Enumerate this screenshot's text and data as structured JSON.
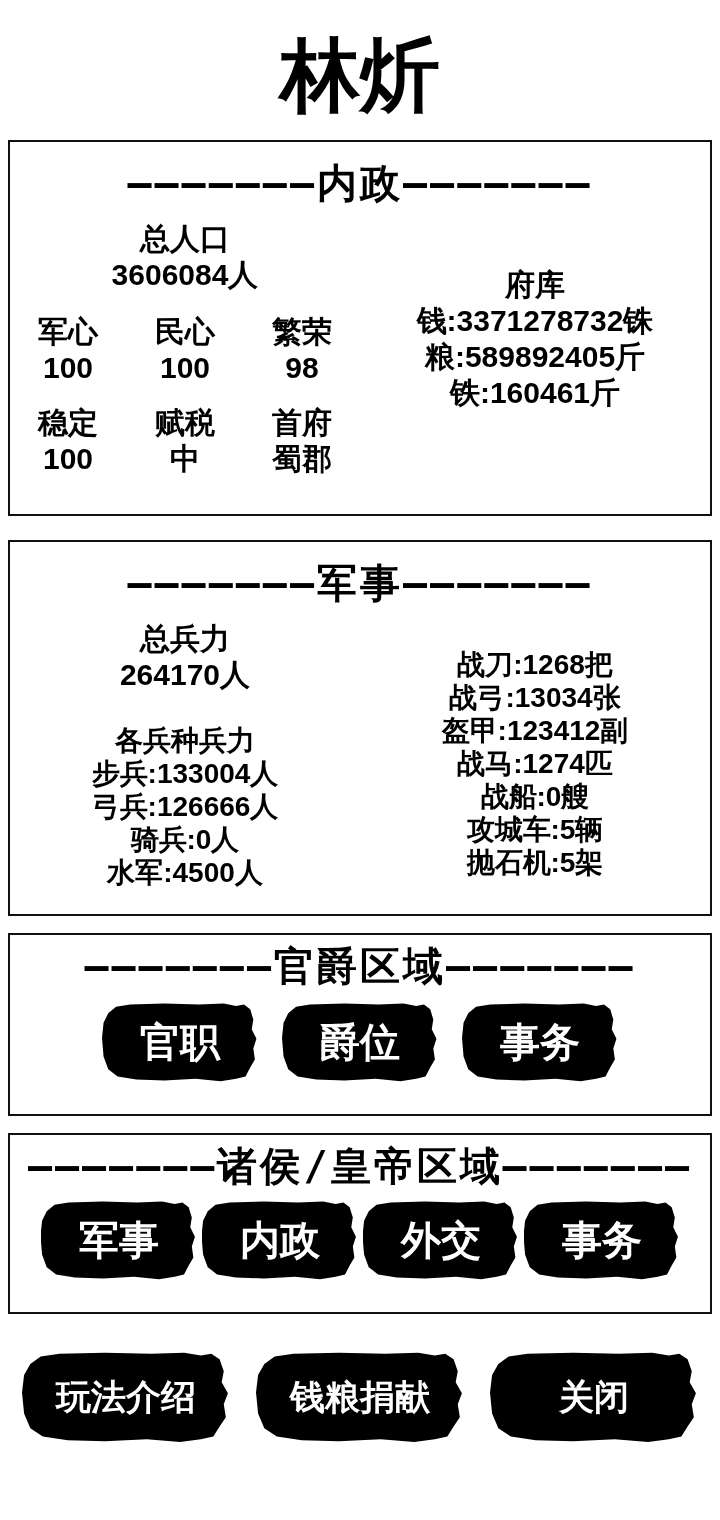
{
  "title": "林炘",
  "sections": [
    {
      "kind": "domestic",
      "heading": "———————内政———————",
      "population": {
        "label": "总人口",
        "value": "3606084人"
      },
      "stats": [
        {
          "label": "军心",
          "value": "100"
        },
        {
          "label": "民心",
          "value": "100"
        },
        {
          "label": "繁荣",
          "value": "98"
        },
        {
          "label": "稳定",
          "value": "100"
        },
        {
          "label": "赋税",
          "value": "中"
        },
        {
          "label": "首府",
          "value": "蜀郡"
        }
      ],
      "treasury": {
        "label": "府库",
        "items": [
          "钱:3371278732铢",
          "粮:589892405斤",
          "铁:160461斤"
        ]
      }
    },
    {
      "kind": "military",
      "heading": "———————军事———————",
      "total": {
        "label": "总兵力",
        "value": "264170人"
      },
      "troops": {
        "label": "各兵种兵力",
        "items": [
          "步兵:133004人",
          "弓兵:126666人",
          "骑兵:0人",
          "水军:4500人"
        ]
      },
      "equipment": [
        "战刀:1268把",
        "战弓:13034张",
        "盔甲:123412副",
        "战马:1274匹",
        "战船:0艘",
        "攻城车:5辆",
        "抛石机:5架"
      ]
    },
    {
      "kind": "buttons",
      "heading": "———————官爵区域———————",
      "buttons": [
        "官职",
        "爵位",
        "事务"
      ]
    },
    {
      "kind": "buttons",
      "heading": "———————诸侯/皇帝区域———————",
      "buttons": [
        "军事",
        "内政",
        "外交",
        "事务"
      ]
    }
  ],
  "footer_buttons": [
    "玩法介绍",
    "钱粮捐献",
    "关闭"
  ]
}
